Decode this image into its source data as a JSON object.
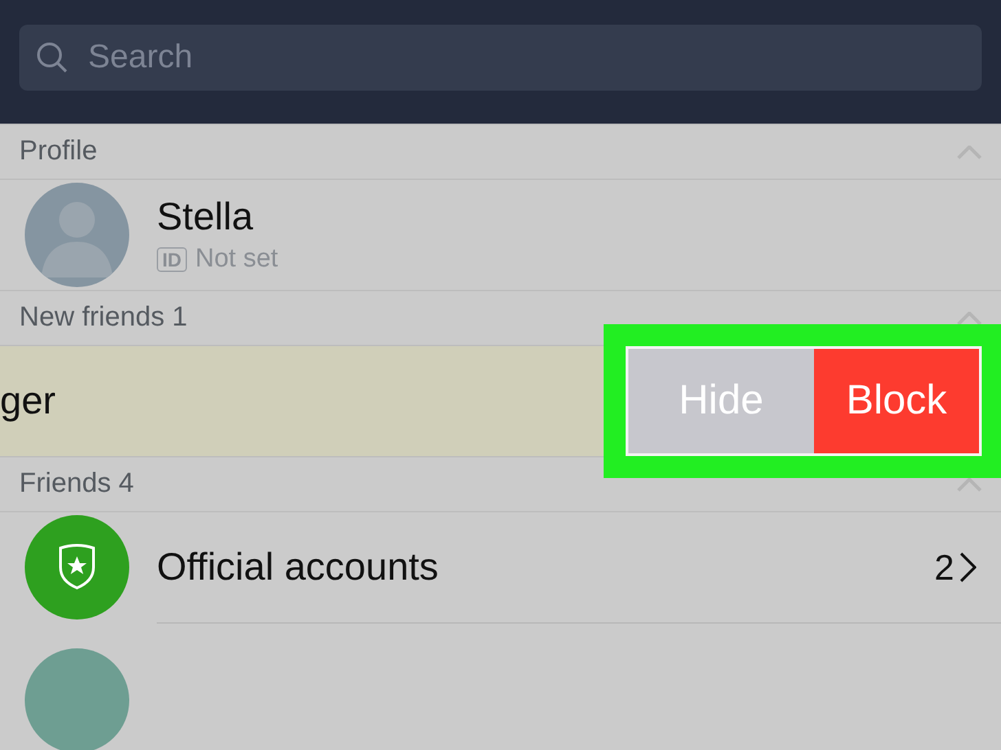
{
  "search": {
    "placeholder": "Search"
  },
  "sections": [
    {
      "title": "Profile",
      "expanded": true,
      "rows": [
        {
          "kind": "profile",
          "name": "Stella",
          "id_badge": "ID",
          "id_value": "Not set"
        }
      ]
    },
    {
      "title": "New friends 1",
      "expanded": true,
      "rows": [
        {
          "kind": "swiped",
          "name": "ger",
          "highlighted": true,
          "actions": [
            {
              "kind": "hide",
              "label": "Hide"
            },
            {
              "kind": "block",
              "label": "Block"
            }
          ]
        }
      ]
    },
    {
      "title": "Friends 4",
      "expanded": true,
      "rows": [
        {
          "kind": "official",
          "name": "Official accounts",
          "count": "2"
        },
        {
          "kind": "friend"
        }
      ]
    }
  ]
}
